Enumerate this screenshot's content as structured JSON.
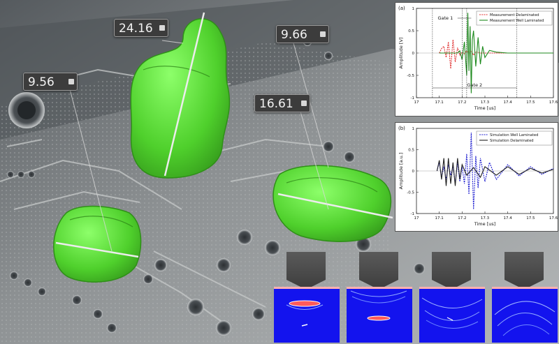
{
  "measurements": [
    {
      "label": "24.16",
      "icon": "menu-square-icon"
    },
    {
      "label": "9.66",
      "icon": "menu-square-icon"
    },
    {
      "label": "9.56",
      "icon": "menu-square-icon"
    },
    {
      "label": "16.61",
      "icon": "menu-square-icon"
    }
  ],
  "colors": {
    "blob": "#5ee03c",
    "board": "#8a8d8f",
    "label_bg": "#3c3c3c",
    "sim_bg": "#1a1aff"
  },
  "chart_a": {
    "panel_label": "(a)",
    "ylabel": "Amplitude [V]",
    "xlabel": "Time [us]",
    "xticks": [
      "17",
      "17.1",
      "17.2",
      "17.3",
      "17.4",
      "17.5",
      "17.6"
    ],
    "yticks": [
      "1",
      "0.5",
      "0",
      "-0.5",
      "-1"
    ],
    "legend": [
      "Measurement Delaminated",
      "Measurement Well Laminated"
    ],
    "gate1_label": "Gate 1",
    "gate2_label": "Gate 2"
  },
  "chart_b": {
    "panel_label": "(b)",
    "ylabel": "Amplitude [a.u.]",
    "xlabel": "Time [us]",
    "xticks": [
      "17",
      "17.1",
      "17.2",
      "17.3",
      "17.4",
      "17.5",
      "17.6"
    ],
    "yticks": [
      "1",
      "0.5",
      "0",
      "-0.5",
      "-1"
    ],
    "legend": [
      "Simulation Well Laminated",
      "Simulation Delaminated"
    ]
  },
  "chart_data": [
    {
      "type": "line",
      "title": "(a)",
      "xlabel": "Time [us]",
      "ylabel": "Amplitude [V]",
      "xlim": [
        17.0,
        17.6
      ],
      "ylim": [
        -1,
        1
      ],
      "series": [
        {
          "name": "Measurement Delaminated",
          "color": "#e03030",
          "style": "dashed",
          "x": [
            17.1,
            17.11,
            17.12,
            17.13,
            17.14,
            17.15,
            17.16,
            17.17,
            17.18,
            17.19,
            17.2,
            17.21,
            17.22,
            17.23,
            17.24,
            17.25,
            17.26,
            17.28,
            17.3,
            17.35,
            17.4,
            17.45,
            17.5,
            17.55,
            17.6
          ],
          "y": [
            0.0,
            0.1,
            0.15,
            -0.1,
            0.25,
            -0.35,
            0.3,
            -0.2,
            0.12,
            -0.05,
            0.02,
            -0.02,
            0.05,
            0.0,
            0.05,
            -0.05,
            0.03,
            0.0,
            0.0,
            0.0,
            0.0,
            0.0,
            0.0,
            0.0,
            0.0
          ]
        },
        {
          "name": "Measurement Well Laminated",
          "color": "#1e8a1e",
          "style": "solid",
          "x": [
            17.1,
            17.15,
            17.18,
            17.19,
            17.2,
            17.21,
            17.22,
            17.225,
            17.23,
            17.235,
            17.24,
            17.245,
            17.25,
            17.26,
            17.27,
            17.28,
            17.29,
            17.3,
            17.32,
            17.35,
            17.4,
            17.45,
            17.5,
            17.55,
            17.6
          ],
          "y": [
            0.0,
            0.0,
            0.0,
            0.05,
            -0.15,
            0.25,
            -0.5,
            0.9,
            -0.4,
            0.6,
            -0.9,
            0.3,
            0.5,
            -0.3,
            0.35,
            -0.25,
            0.15,
            -0.1,
            0.06,
            0.02,
            0.0,
            0.0,
            0.0,
            0.0,
            0.0
          ]
        }
      ]
    },
    {
      "type": "line",
      "title": "(b)",
      "xlabel": "Time [us]",
      "ylabel": "Amplitude [a.u.]",
      "xlim": [
        17.0,
        17.6
      ],
      "ylim": [
        -1,
        1
      ],
      "series": [
        {
          "name": "Simulation Well Laminated",
          "color": "#2020d0",
          "style": "dashed",
          "x": [
            17.09,
            17.1,
            17.11,
            17.12,
            17.13,
            17.14,
            17.15,
            17.16,
            17.17,
            17.18,
            17.19,
            17.2,
            17.21,
            17.22,
            17.23,
            17.24,
            17.25,
            17.26,
            17.27,
            17.28,
            17.3,
            17.32,
            17.35,
            17.4,
            17.45,
            17.5,
            17.55,
            17.6
          ],
          "y": [
            0.0,
            0.2,
            -0.15,
            0.1,
            -0.2,
            0.15,
            -0.1,
            0.1,
            -0.3,
            0.2,
            -0.25,
            0.1,
            -0.3,
            0.4,
            -0.55,
            0.9,
            -0.9,
            0.35,
            -0.4,
            0.3,
            -0.25,
            0.2,
            -0.2,
            0.15,
            -0.12,
            0.1,
            -0.08,
            0.06
          ]
        },
        {
          "name": "Simulation Delaminated",
          "color": "#202020",
          "style": "solid",
          "x": [
            17.09,
            17.1,
            17.11,
            17.12,
            17.13,
            17.14,
            17.15,
            17.16,
            17.17,
            17.18,
            17.19,
            17.2,
            17.22,
            17.25,
            17.28,
            17.3,
            17.35,
            17.4,
            17.45,
            17.5,
            17.55,
            17.6
          ],
          "y": [
            0.0,
            0.25,
            -0.2,
            0.3,
            -0.35,
            0.3,
            -0.3,
            0.2,
            -0.35,
            0.3,
            -0.2,
            0.15,
            -0.1,
            0.08,
            -0.15,
            0.1,
            -0.1,
            0.1,
            -0.08,
            0.06,
            -0.05,
            0.04
          ]
        }
      ]
    }
  ]
}
